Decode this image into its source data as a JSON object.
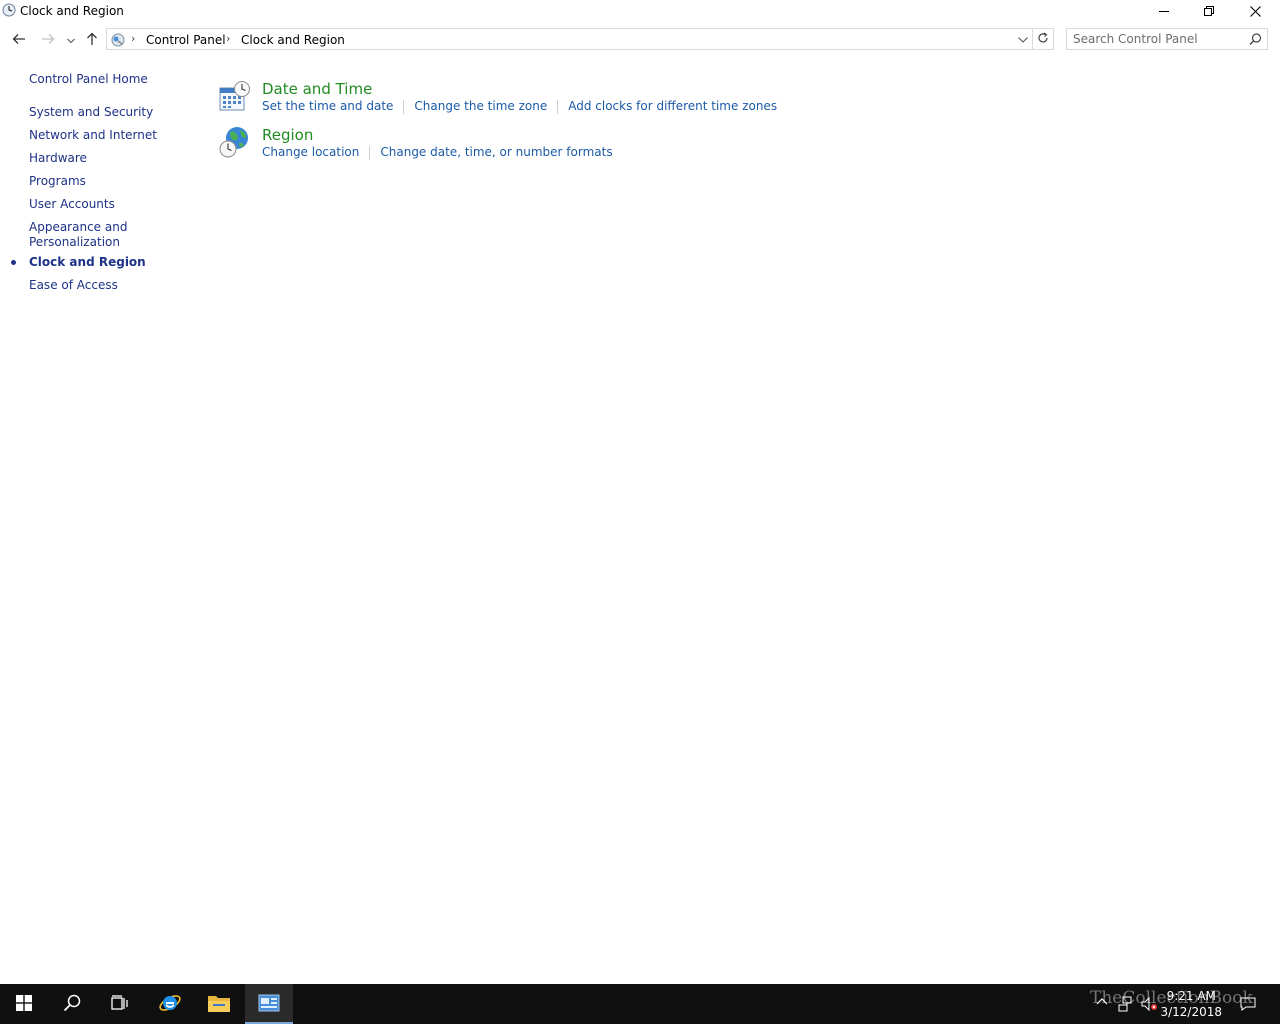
{
  "window": {
    "title": "Clock and Region",
    "icons": [
      "clock-region-icon",
      "minimize-icon",
      "restore-icon",
      "close-icon"
    ]
  },
  "navbar": {
    "breadcrumb": [
      "Control Panel",
      "Clock and Region"
    ],
    "search_placeholder": "Search Control Panel",
    "icons": [
      "back-arrow-icon",
      "forward-arrow-icon",
      "recent-dropdown-icon",
      "up-arrow-icon",
      "control-panel-icon",
      "chevron-down-icon",
      "refresh-icon",
      "search-icon"
    ]
  },
  "sidebar": {
    "home": "Control Panel Home",
    "items": [
      {
        "label": "System and Security"
      },
      {
        "label": "Network and Internet"
      },
      {
        "label": "Hardware"
      },
      {
        "label": "Programs"
      },
      {
        "label": "User Accounts"
      },
      {
        "label": "Appearance and"
      },
      {
        "label": "Personalization"
      },
      {
        "label": "Clock and Region",
        "current": true
      },
      {
        "label": "Ease of Access"
      }
    ]
  },
  "categories": [
    {
      "title": "Date and Time",
      "icon": "date-time-icon",
      "links": [
        "Set the time and date",
        "Change the time zone",
        "Add clocks for different time zones"
      ]
    },
    {
      "title": "Region",
      "icon": "region-globe-icon",
      "links": [
        "Change location",
        "Change date, time, or number formats"
      ]
    }
  ],
  "taskbar": {
    "icons": [
      "windows-start-icon",
      "search-icon",
      "task-view-icon",
      "internet-explorer-icon",
      "file-explorer-icon",
      "control-panel-icon"
    ],
    "tray_icons": [
      "show-hidden-icons-icon",
      "network-icon",
      "volume-muted-icon",
      "action-center-icon"
    ],
    "time": "9:21 AM",
    "date": "3/12/2018",
    "watermark": "TheCollectionBook"
  },
  "colors": {
    "link": "#1c5ba8",
    "sidebar_link": "#1e3287",
    "category_title": "#228b22",
    "taskbar": "#101010"
  }
}
